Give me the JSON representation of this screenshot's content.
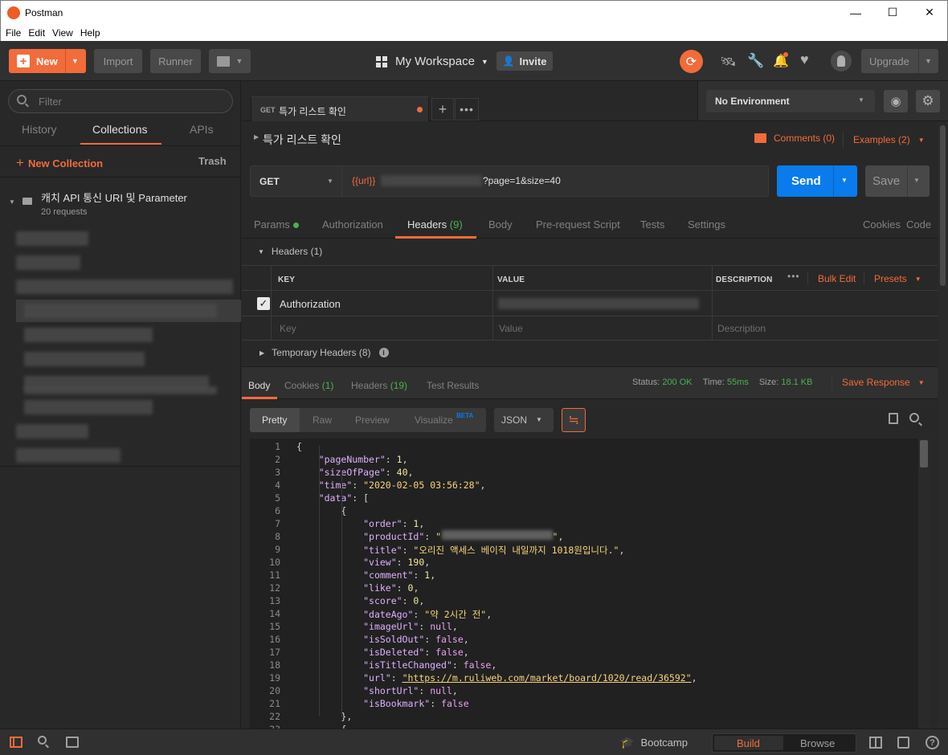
{
  "window": {
    "title": "Postman",
    "minimize": "—",
    "maximize": "☐",
    "close": "✕"
  },
  "menu": [
    "File",
    "Edit",
    "View",
    "Help"
  ],
  "toolbar": {
    "new_label": "New",
    "import_label": "Import",
    "runner_label": "Runner",
    "workspace_label": "My Workspace",
    "invite_label": "Invite",
    "upgrade_label": "Upgrade"
  },
  "sidebar": {
    "filter_placeholder": "Filter",
    "tabs": [
      "History",
      "Collections",
      "APIs"
    ],
    "new_collection": "New Collection",
    "trash": "Trash",
    "collection": {
      "name": "캐치 API 통신 URI 및 Parameter",
      "count": "20 requests"
    }
  },
  "request": {
    "tab_method": "GET",
    "tab_title": "특가 리스트 확인",
    "name": "특가 리스트 확인",
    "comments": "Comments (0)",
    "examples": "Examples (2)",
    "method": "GET",
    "url_var": "{{url}}",
    "url_query": "?page=1&size=40",
    "send": "Send",
    "save": "Save",
    "environment": "No Environment"
  },
  "req_tabs": {
    "params": "Params",
    "authorization": "Authorization",
    "headers": "Headers",
    "headers_count": "(9)",
    "body": "Body",
    "prerequest": "Pre-request Script",
    "tests": "Tests",
    "settings": "Settings",
    "cookies": "Cookies",
    "code": "Code"
  },
  "headers": {
    "section": "Headers (1)",
    "col_key": "KEY",
    "col_value": "VALUE",
    "col_desc": "DESCRIPTION",
    "bulk_edit": "Bulk Edit",
    "presets": "Presets",
    "row_key": "Authorization",
    "ph_key": "Key",
    "ph_value": "Value",
    "ph_desc": "Description",
    "temporary": "Temporary Headers (8)"
  },
  "response": {
    "tabs": {
      "body": "Body",
      "cookies": "Cookies",
      "cookies_count": "(1)",
      "headers": "Headers",
      "headers_count": "(19)",
      "tests": "Test Results"
    },
    "status_label": "Status:",
    "status": "200 OK",
    "time_label": "Time:",
    "time": "55ms",
    "size_label": "Size:",
    "size": "18.1 KB",
    "save_response": "Save Response",
    "views": [
      "Pretty",
      "Raw",
      "Preview",
      "Visualize"
    ],
    "beta": "BETA",
    "format": "JSON"
  },
  "json_lines": [
    {
      "n": "1",
      "indent": "",
      "parts": [
        [
          "pu",
          "{"
        ]
      ]
    },
    {
      "n": "2",
      "indent": "    ",
      "parts": [
        [
          "k",
          "\"pageNumber\""
        ],
        [
          "pu",
          ": "
        ],
        [
          "n",
          "1"
        ],
        [
          "pu",
          ","
        ]
      ]
    },
    {
      "n": "3",
      "indent": "    ",
      "parts": [
        [
          "k",
          "\"sizeOfPage\""
        ],
        [
          "pu",
          ": "
        ],
        [
          "n",
          "40"
        ],
        [
          "pu",
          ","
        ]
      ]
    },
    {
      "n": "4",
      "indent": "    ",
      "parts": [
        [
          "k",
          "\"time\""
        ],
        [
          "pu",
          ": "
        ],
        [
          "s",
          "\"2020-02-05 03:56:28\""
        ],
        [
          "pu",
          ","
        ]
      ]
    },
    {
      "n": "5",
      "indent": "    ",
      "parts": [
        [
          "k",
          "\"data\""
        ],
        [
          "pu",
          ": ["
        ]
      ]
    },
    {
      "n": "6",
      "indent": "        ",
      "parts": [
        [
          "pu",
          "{"
        ]
      ]
    },
    {
      "n": "7",
      "indent": "            ",
      "parts": [
        [
          "k",
          "\"order\""
        ],
        [
          "pu",
          ": "
        ],
        [
          "n",
          "1"
        ],
        [
          "pu",
          ","
        ]
      ]
    },
    {
      "n": "8",
      "indent": "            ",
      "parts": [
        [
          "k",
          "\"productId\""
        ],
        [
          "pu",
          ": "
        ],
        [
          "s",
          "\"                    \""
        ],
        [
          "pu",
          ","
        ]
      ]
    },
    {
      "n": "9",
      "indent": "            ",
      "parts": [
        [
          "k",
          "\"title\""
        ],
        [
          "pu",
          ": "
        ],
        [
          "s",
          "\"오리진 액세스 베이직 내일까지 1018원입니다.\""
        ],
        [
          "pu",
          ","
        ]
      ]
    },
    {
      "n": "10",
      "indent": "            ",
      "parts": [
        [
          "k",
          "\"view\""
        ],
        [
          "pu",
          ": "
        ],
        [
          "n",
          "190"
        ],
        [
          "pu",
          ","
        ]
      ]
    },
    {
      "n": "11",
      "indent": "            ",
      "parts": [
        [
          "k",
          "\"comment\""
        ],
        [
          "pu",
          ": "
        ],
        [
          "n",
          "1"
        ],
        [
          "pu",
          ","
        ]
      ]
    },
    {
      "n": "12",
      "indent": "            ",
      "parts": [
        [
          "k",
          "\"like\""
        ],
        [
          "pu",
          ": "
        ],
        [
          "n",
          "0"
        ],
        [
          "pu",
          ","
        ]
      ]
    },
    {
      "n": "13",
      "indent": "            ",
      "parts": [
        [
          "k",
          "\"score\""
        ],
        [
          "pu",
          ": "
        ],
        [
          "n",
          "0"
        ],
        [
          "pu",
          ","
        ]
      ]
    },
    {
      "n": "14",
      "indent": "            ",
      "parts": [
        [
          "k",
          "\"dateAgo\""
        ],
        [
          "pu",
          ": "
        ],
        [
          "s",
          "\"약 2시간 전\""
        ],
        [
          "pu",
          ","
        ]
      ]
    },
    {
      "n": "15",
      "indent": "            ",
      "parts": [
        [
          "k",
          "\"imageUrl\""
        ],
        [
          "pu",
          ": "
        ],
        [
          "kw",
          "null"
        ],
        [
          "pu",
          ","
        ]
      ]
    },
    {
      "n": "16",
      "indent": "            ",
      "parts": [
        [
          "k",
          "\"isSoldOut\""
        ],
        [
          "pu",
          ": "
        ],
        [
          "kw",
          "false"
        ],
        [
          "pu",
          ","
        ]
      ]
    },
    {
      "n": "17",
      "indent": "            ",
      "parts": [
        [
          "k",
          "\"isDeleted\""
        ],
        [
          "pu",
          ": "
        ],
        [
          "kw",
          "false"
        ],
        [
          "pu",
          ","
        ]
      ]
    },
    {
      "n": "18",
      "indent": "            ",
      "parts": [
        [
          "k",
          "\"isTitleChanged\""
        ],
        [
          "pu",
          ": "
        ],
        [
          "kw",
          "false"
        ],
        [
          "pu",
          ","
        ]
      ]
    },
    {
      "n": "19",
      "indent": "            ",
      "parts": [
        [
          "k",
          "\"url\""
        ],
        [
          "pu",
          ": "
        ],
        [
          "url",
          "\"https://m.ruliweb.com/market/board/1020/read/36592\""
        ],
        [
          "pu",
          ","
        ]
      ]
    },
    {
      "n": "20",
      "indent": "            ",
      "parts": [
        [
          "k",
          "\"shortUrl\""
        ],
        [
          "pu",
          ": "
        ],
        [
          "kw",
          "null"
        ],
        [
          "pu",
          ","
        ]
      ]
    },
    {
      "n": "21",
      "indent": "            ",
      "parts": [
        [
          "k",
          "\"isBookmark\""
        ],
        [
          "pu",
          ": "
        ],
        [
          "kw",
          "false"
        ]
      ]
    },
    {
      "n": "22",
      "indent": "        ",
      "parts": [
        [
          "pu",
          "},"
        ]
      ]
    },
    {
      "n": "23",
      "indent": "        ",
      "parts": [
        [
          "pu",
          "{"
        ]
      ]
    }
  ],
  "statusbar": {
    "bootcamp": "Bootcamp",
    "build": "Build",
    "browse": "Browse"
  },
  "colors": {
    "accent": "#f26b3a",
    "send": "#097bed",
    "ok": "#4cb050"
  }
}
